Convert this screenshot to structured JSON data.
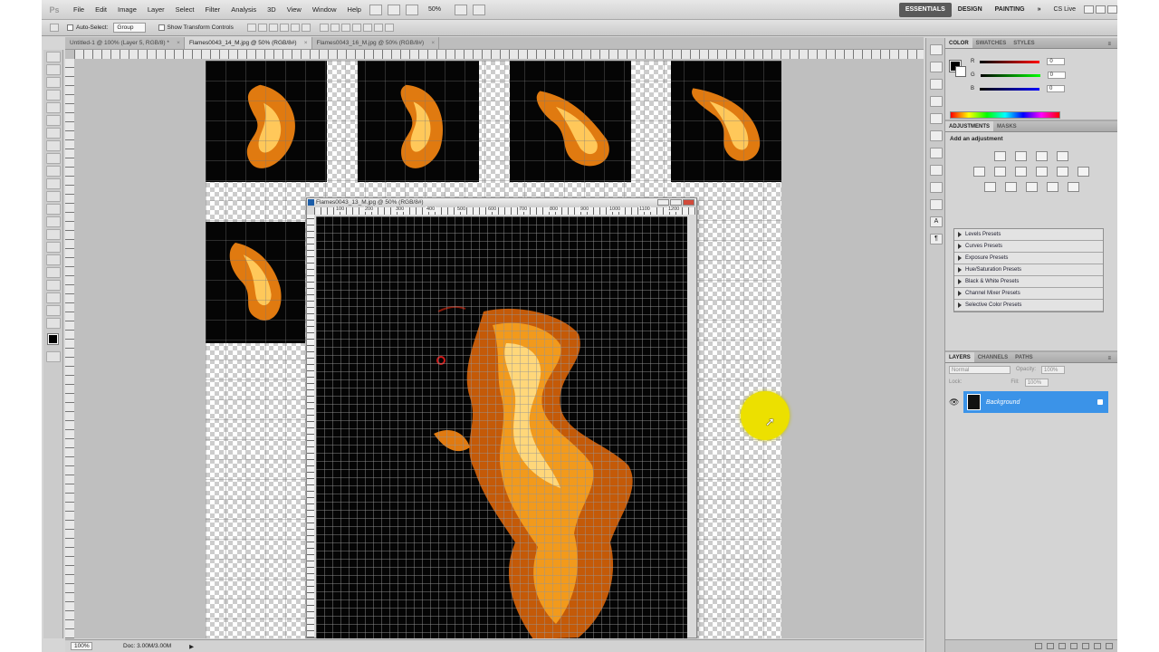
{
  "app": {
    "logo": "Ps"
  },
  "menu": [
    "File",
    "Edit",
    "Image",
    "Layer",
    "Select",
    "Filter",
    "Analysis",
    "3D",
    "View",
    "Window",
    "Help"
  ],
  "zoom_level": "50%",
  "workspaces": {
    "essentials": "ESSENTIALS",
    "design": "DESIGN",
    "painting": "PAINTING",
    "more": "»",
    "cslive": "CS Live"
  },
  "options_bar": {
    "auto_select_label": "Auto-Select:",
    "auto_select_value": "Group",
    "transform_label": "Show Transform Controls"
  },
  "doc_tabs": [
    {
      "label": "Untitled-1 @ 100% (Layer 5, RGB/8) *"
    },
    {
      "label": "Flames0043_14_M.jpg @ 50% (RGB/8#)"
    },
    {
      "label": "Flames0043_16_M.jpg @ 50% (RGB/8#)"
    }
  ],
  "floating_doc": {
    "title": "Flames0043_13_M.jpg @ 50% (RGB/8#)",
    "ruler": [
      "100",
      "200",
      "300",
      "400",
      "500",
      "600",
      "700",
      "800",
      "900",
      "1000",
      "1100",
      "1200"
    ]
  },
  "status": {
    "zoom": "100%",
    "doc": "Doc: 3.00M/3.00M"
  },
  "panels": {
    "color_tabs": [
      "COLOR",
      "SWATCHES",
      "STYLES"
    ],
    "color": {
      "r_label": "R",
      "g_label": "G",
      "b_label": "B",
      "r": "0",
      "g": "0",
      "b": "0"
    },
    "adj_tabs": [
      "ADJUSTMENTS",
      "MASKS"
    ],
    "adj_title": "Add an adjustment",
    "presets": [
      "Levels Presets",
      "Curves Presets",
      "Exposure Presets",
      "Hue/Saturation Presets",
      "Black & White Presets",
      "Channel Mixer Presets",
      "Selective Color Presets"
    ],
    "layer_tabs": [
      "LAYERS",
      "CHANNELS",
      "PATHS"
    ],
    "blend_mode": "Normal",
    "opacity_label": "Opacity:",
    "opacity": "100%",
    "lock_label": "Lock:",
    "fill_label": "Fill:",
    "fill": "100%",
    "layer_name": "Background"
  },
  "colors": {
    "accent": "#3b93e8",
    "highlight": "#ece000",
    "fire": "#f29a1c"
  }
}
